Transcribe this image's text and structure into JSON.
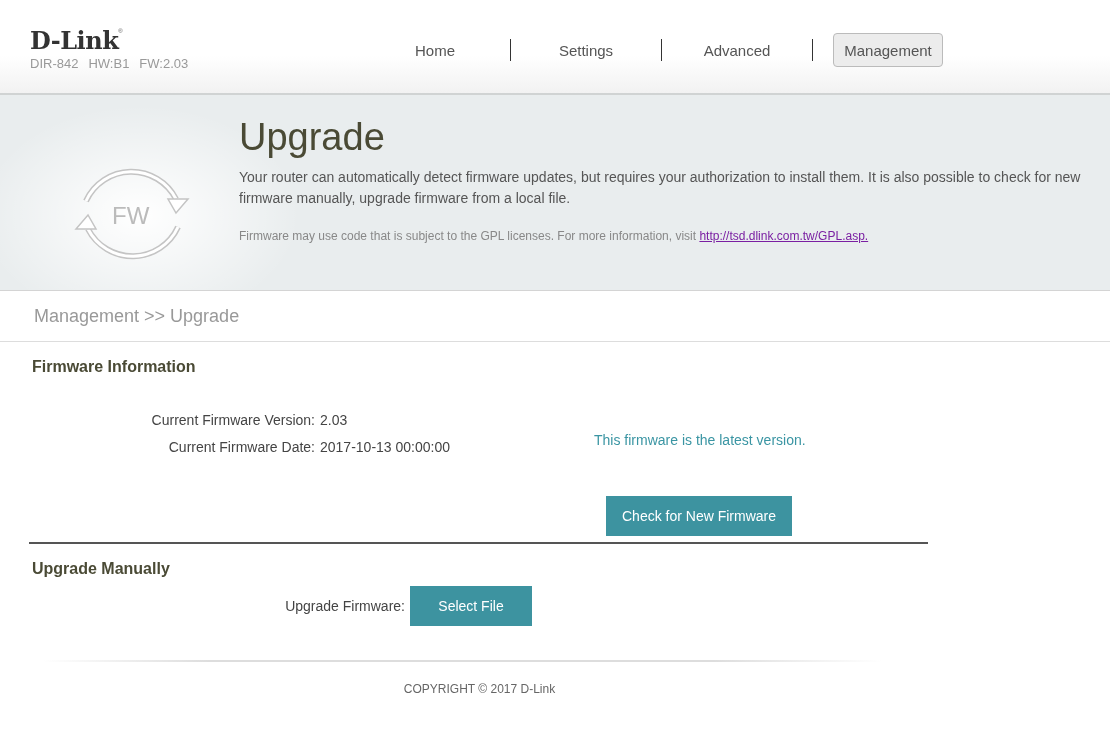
{
  "header": {
    "logo": "D-Link",
    "logo_mark": "®",
    "model": "DIR-842",
    "hw": "HW:B1",
    "fw": "FW:2.03"
  },
  "nav": [
    {
      "label": "Home",
      "selected": false
    },
    {
      "label": "Settings",
      "selected": false
    },
    {
      "label": "Advanced",
      "selected": false
    },
    {
      "label": "Management",
      "selected": true
    }
  ],
  "banner": {
    "icon_text": "FW",
    "title": "Upgrade",
    "description": "Your router can automatically detect firmware updates, but requires your authorization to install them. It is also possible to check for new firmware manually, upgrade firmware from a local file.",
    "note": "Firmware may use code that is subject to the GPL licenses. For more information, visit",
    "link": "http://tsd.dlink.com.tw/GPL.asp."
  },
  "breadcrumb": "Management >> Upgrade",
  "firmware_information": {
    "heading": "Firmware Information",
    "fields": [
      {
        "label": "Current Firmware Version:",
        "value": "2.03"
      },
      {
        "label": "Current Firmware Date:",
        "value": "2017-10-13 00:00:00"
      }
    ],
    "status": "This firmware is the latest version.",
    "button": "Check for New Firmware"
  },
  "upgrade_manually": {
    "heading": "Upgrade Manually",
    "label": "Upgrade Firmware:",
    "button": "Select File"
  },
  "footer": "COPYRIGHT © 2017 D-Link"
}
